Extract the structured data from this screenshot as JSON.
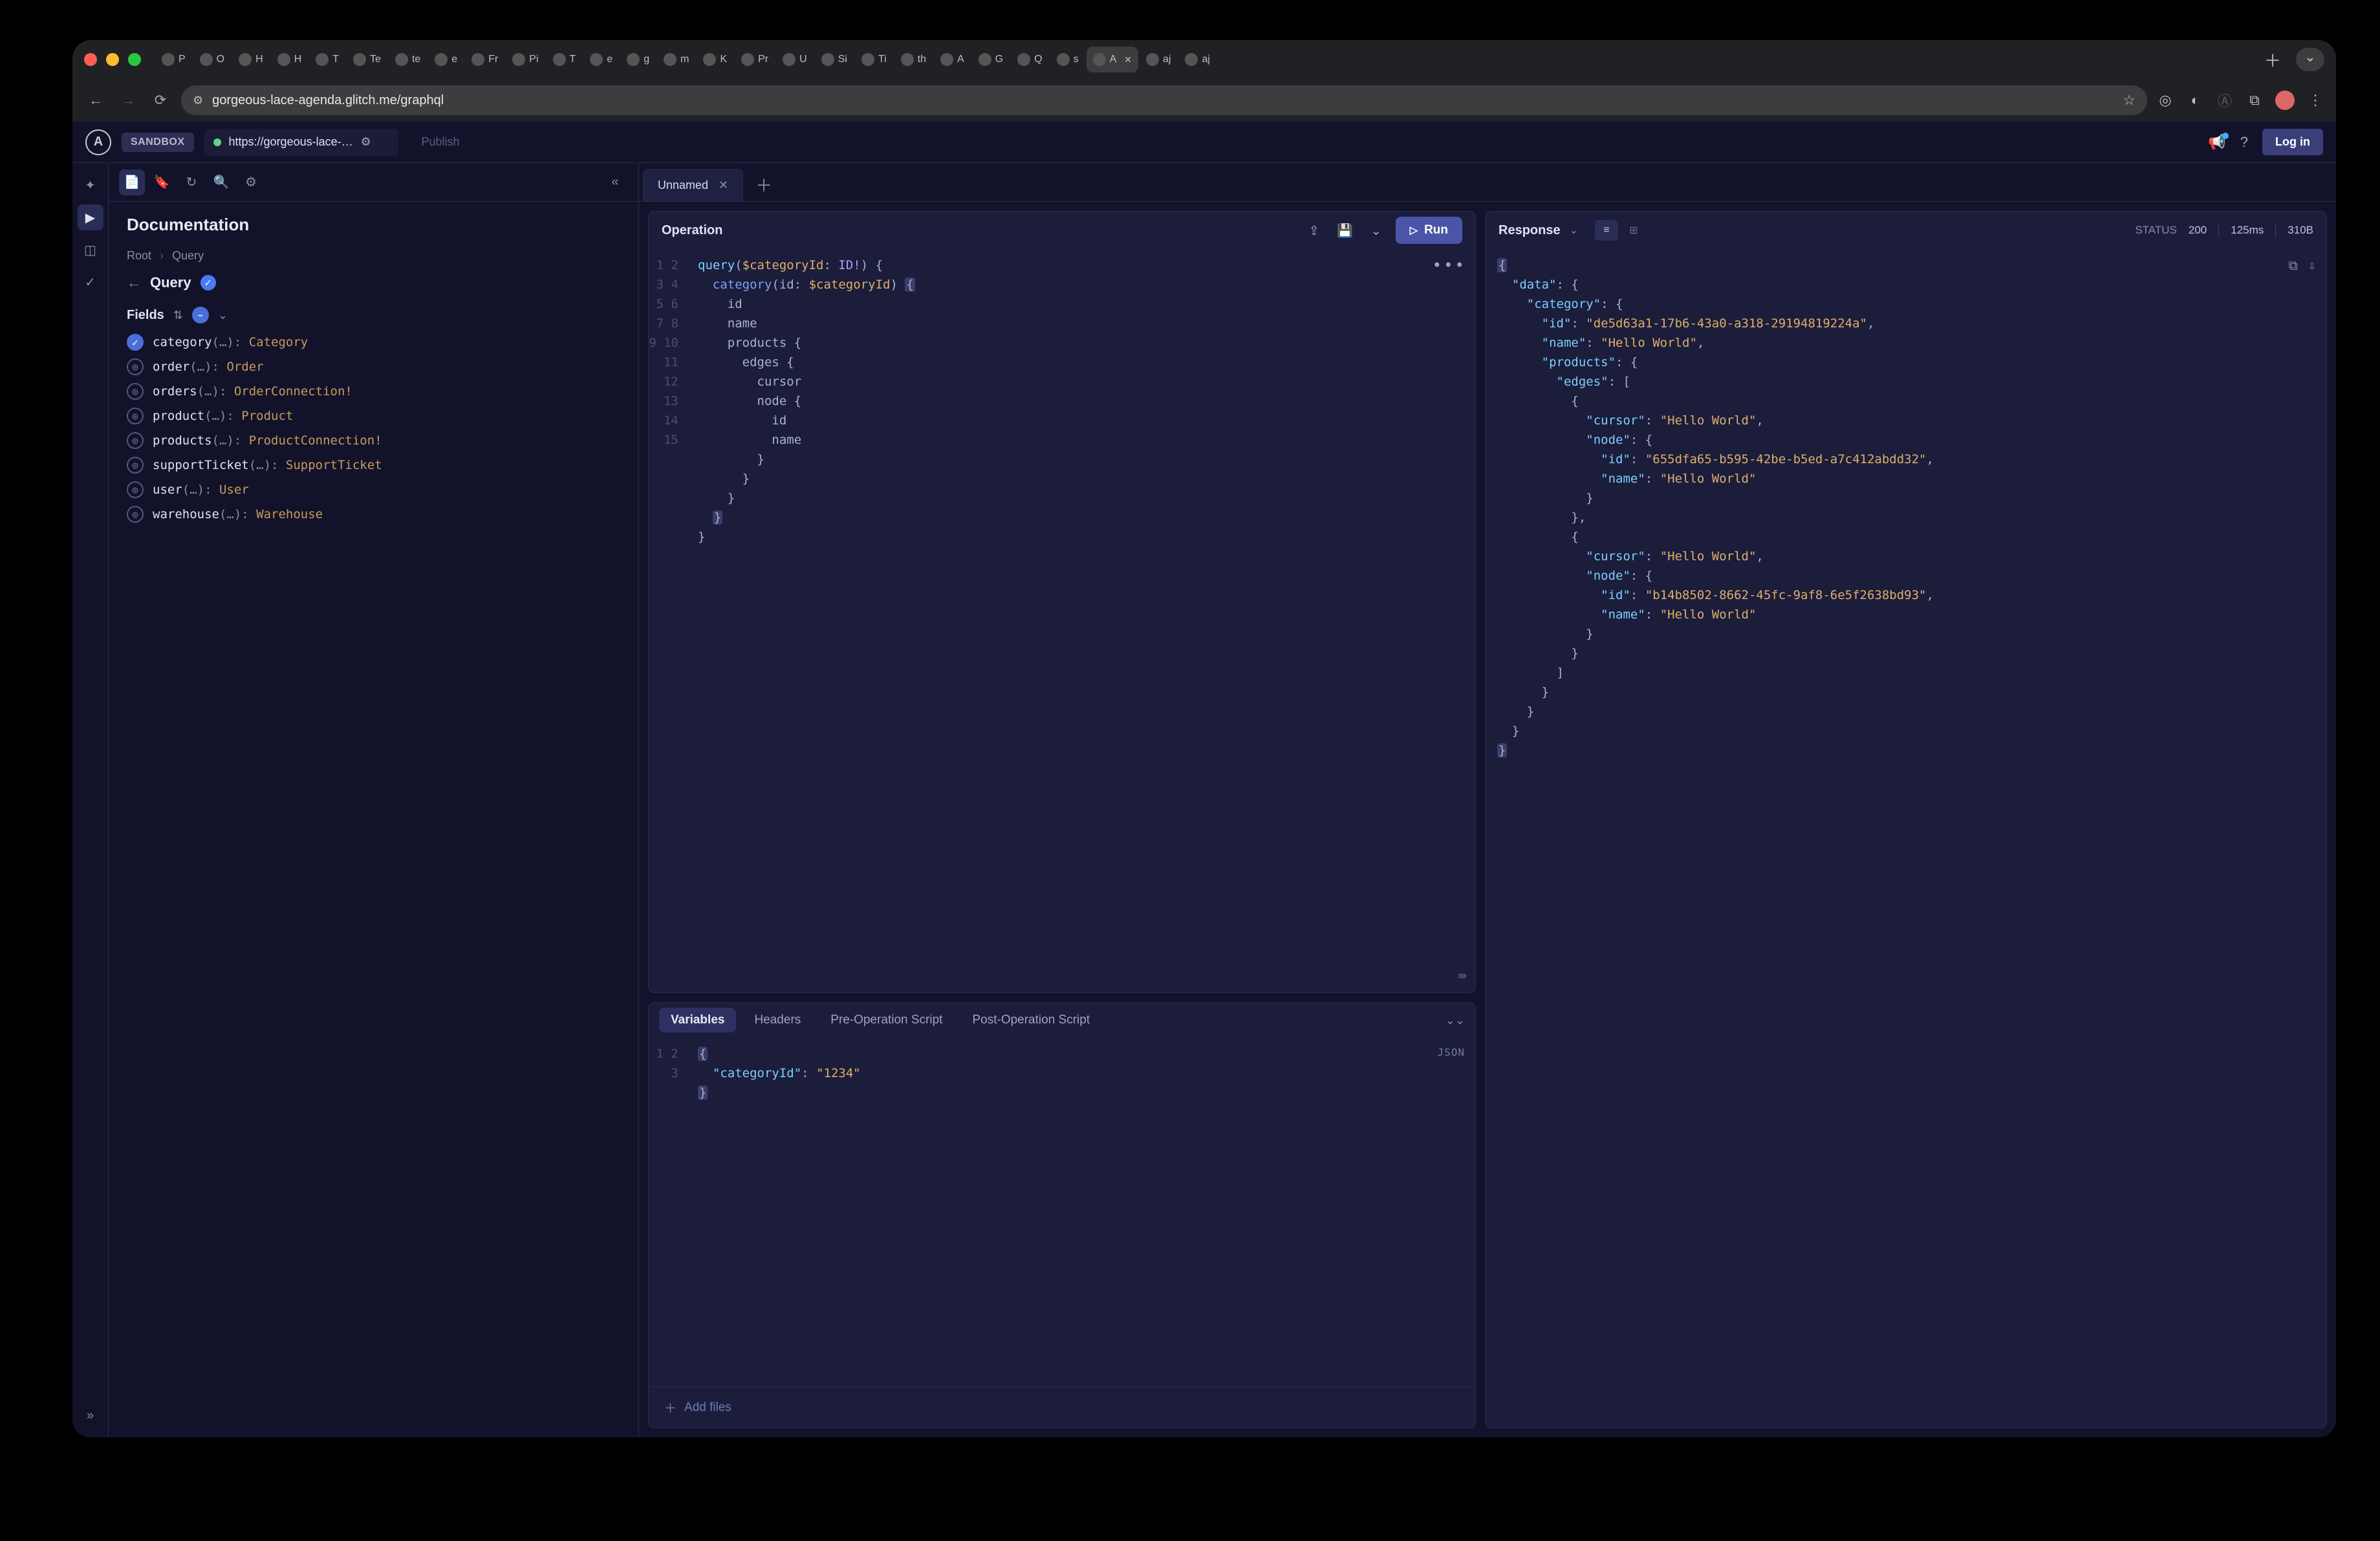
{
  "browser": {
    "url": "gorgeous-lace-agenda.glitch.me/graphql",
    "tabs": [
      "P",
      "O",
      "H",
      "H",
      "T",
      "Te",
      "te",
      "e",
      "Fr",
      "Pi",
      "T",
      "e",
      "g",
      "m",
      "K",
      "Pr",
      "U",
      "Si",
      "Ti",
      "th",
      "A",
      "G",
      "Q",
      "s",
      "A",
      "aj",
      "aj"
    ],
    "active_tab_index": 24
  },
  "header": {
    "sandbox_label": "SANDBOX",
    "endpoint": "https://gorgeous-lace-…",
    "publish": "Publish",
    "login": "Log in"
  },
  "sidebar": {
    "title": "Documentation",
    "breadcrumb": {
      "root": "Root",
      "current": "Query"
    },
    "query_label": "Query",
    "fields_label": "Fields",
    "fields": [
      {
        "checked": true,
        "name": "category",
        "args": "(…)",
        "type": "Category"
      },
      {
        "checked": false,
        "name": "order",
        "args": "(…)",
        "type": "Order"
      },
      {
        "checked": false,
        "name": "orders",
        "args": "(…)",
        "type": "OrderConnection!"
      },
      {
        "checked": false,
        "name": "product",
        "args": "(…)",
        "type": "Product"
      },
      {
        "checked": false,
        "name": "products",
        "args": "(…)",
        "type": "ProductConnection!"
      },
      {
        "checked": false,
        "name": "supportTicket",
        "args": "(…)",
        "type": "SupportTicket"
      },
      {
        "checked": false,
        "name": "user",
        "args": "(…)",
        "type": "User"
      },
      {
        "checked": false,
        "name": "warehouse",
        "args": "(…)",
        "type": "Warehouse"
      }
    ]
  },
  "editor": {
    "tab_name": "Unnamed",
    "operation_label": "Operation",
    "run_label": "Run",
    "query_lines": [
      {
        "n": 1,
        "tokens": [
          [
            "kw",
            "query"
          ],
          [
            "pu",
            "("
          ],
          [
            "va",
            "$categoryId"
          ],
          [
            "pu",
            ": "
          ],
          [
            "ty",
            "ID!"
          ],
          [
            "pu",
            ") {"
          ]
        ]
      },
      {
        "n": 2,
        "indent": 1,
        "tokens": [
          [
            "fn",
            "category"
          ],
          [
            "pu",
            "(id: "
          ],
          [
            "va",
            "$categoryId"
          ],
          [
            "pu",
            ") "
          ],
          [
            "hl",
            "{"
          ]
        ]
      },
      {
        "n": 3,
        "indent": 2,
        "tokens": [
          [
            "pu",
            "id"
          ]
        ]
      },
      {
        "n": 4,
        "indent": 2,
        "tokens": [
          [
            "pu",
            "name"
          ]
        ]
      },
      {
        "n": 5,
        "indent": 2,
        "tokens": [
          [
            "pu",
            "products {"
          ]
        ]
      },
      {
        "n": 6,
        "indent": 3,
        "tokens": [
          [
            "pu",
            "edges {"
          ]
        ]
      },
      {
        "n": 7,
        "indent": 4,
        "tokens": [
          [
            "pu",
            "cursor"
          ]
        ]
      },
      {
        "n": 8,
        "indent": 4,
        "tokens": [
          [
            "pu",
            "node {"
          ]
        ]
      },
      {
        "n": 9,
        "indent": 5,
        "tokens": [
          [
            "pu",
            "id"
          ]
        ]
      },
      {
        "n": 10,
        "indent": 5,
        "tokens": [
          [
            "pu",
            "name"
          ]
        ]
      },
      {
        "n": 11,
        "indent": 4,
        "tokens": [
          [
            "pu",
            "}"
          ]
        ]
      },
      {
        "n": 12,
        "indent": 3,
        "tokens": [
          [
            "pu",
            "}"
          ]
        ]
      },
      {
        "n": 13,
        "indent": 2,
        "tokens": [
          [
            "pu",
            "}"
          ]
        ]
      },
      {
        "n": 14,
        "indent": 1,
        "tokens": [
          [
            "hl",
            "}"
          ]
        ]
      },
      {
        "n": 15,
        "indent": 0,
        "tokens": [
          [
            "pu",
            "}"
          ]
        ]
      }
    ]
  },
  "variables": {
    "tabs": [
      "Variables",
      "Headers",
      "Pre-Operation Script",
      "Post-Operation Script"
    ],
    "active_tab": 0,
    "json_tag": "JSON",
    "lines": [
      {
        "n": 1,
        "tokens": [
          [
            "hl",
            "{"
          ]
        ]
      },
      {
        "n": 2,
        "indent": 1,
        "tokens": [
          [
            "jk",
            "\"categoryId\""
          ],
          [
            "jp",
            ": "
          ],
          [
            "js",
            "\"1234\""
          ]
        ]
      },
      {
        "n": 3,
        "tokens": [
          [
            "hl",
            "}"
          ]
        ]
      }
    ],
    "add_files": "Add files"
  },
  "response": {
    "title": "Response",
    "status_label": "STATUS",
    "status_code": "200",
    "latency": "125ms",
    "size": "310B",
    "body_lines": [
      [
        [
          "hl",
          "{"
        ]
      ],
      [
        [
          "jp",
          "  "
        ],
        [
          "jk",
          "\"data\""
        ],
        [
          "jp",
          ": {"
        ]
      ],
      [
        [
          "jp",
          "    "
        ],
        [
          "jk",
          "\"category\""
        ],
        [
          "jp",
          ": {"
        ]
      ],
      [
        [
          "jp",
          "      "
        ],
        [
          "jk",
          "\"id\""
        ],
        [
          "jp",
          ": "
        ],
        [
          "js",
          "\"de5d63a1-17b6-43a0-a318-29194819224a\""
        ],
        [
          "jp",
          ","
        ]
      ],
      [
        [
          "jp",
          "      "
        ],
        [
          "jk",
          "\"name\""
        ],
        [
          "jp",
          ": "
        ],
        [
          "js",
          "\"Hello World\""
        ],
        [
          "jp",
          ","
        ]
      ],
      [
        [
          "jp",
          "      "
        ],
        [
          "jk",
          "\"products\""
        ],
        [
          "jp",
          ": {"
        ]
      ],
      [
        [
          "jp",
          "        "
        ],
        [
          "jk",
          "\"edges\""
        ],
        [
          "jp",
          ": ["
        ]
      ],
      [
        [
          "jp",
          "          {"
        ]
      ],
      [
        [
          "jp",
          "            "
        ],
        [
          "jk",
          "\"cursor\""
        ],
        [
          "jp",
          ": "
        ],
        [
          "js",
          "\"Hello World\""
        ],
        [
          "jp",
          ","
        ]
      ],
      [
        [
          "jp",
          "            "
        ],
        [
          "jk",
          "\"node\""
        ],
        [
          "jp",
          ": {"
        ]
      ],
      [
        [
          "jp",
          "              "
        ],
        [
          "jk",
          "\"id\""
        ],
        [
          "jp",
          ": "
        ],
        [
          "js",
          "\"655dfa65-b595-42be-b5ed-a7c412abdd32\""
        ],
        [
          "jp",
          ","
        ]
      ],
      [
        [
          "jp",
          "              "
        ],
        [
          "jk",
          "\"name\""
        ],
        [
          "jp",
          ": "
        ],
        [
          "js",
          "\"Hello World\""
        ]
      ],
      [
        [
          "jp",
          "            }"
        ]
      ],
      [
        [
          "jp",
          "          },"
        ]
      ],
      [
        [
          "jp",
          "          {"
        ]
      ],
      [
        [
          "jp",
          "            "
        ],
        [
          "jk",
          "\"cursor\""
        ],
        [
          "jp",
          ": "
        ],
        [
          "js",
          "\"Hello World\""
        ],
        [
          "jp",
          ","
        ]
      ],
      [
        [
          "jp",
          "            "
        ],
        [
          "jk",
          "\"node\""
        ],
        [
          "jp",
          ": {"
        ]
      ],
      [
        [
          "jp",
          "              "
        ],
        [
          "jk",
          "\"id\""
        ],
        [
          "jp",
          ": "
        ],
        [
          "js",
          "\"b14b8502-8662-45fc-9af8-6e5f2638bd93\""
        ],
        [
          "jp",
          ","
        ]
      ],
      [
        [
          "jp",
          "              "
        ],
        [
          "jk",
          "\"name\""
        ],
        [
          "jp",
          ": "
        ],
        [
          "js",
          "\"Hello World\""
        ]
      ],
      [
        [
          "jp",
          "            }"
        ]
      ],
      [
        [
          "jp",
          "          }"
        ]
      ],
      [
        [
          "jp",
          "        ]"
        ]
      ],
      [
        [
          "jp",
          "      }"
        ]
      ],
      [
        [
          "jp",
          "    }"
        ]
      ],
      [
        [
          "jp",
          "  }"
        ]
      ],
      [
        [
          "hl",
          "}"
        ]
      ]
    ]
  }
}
